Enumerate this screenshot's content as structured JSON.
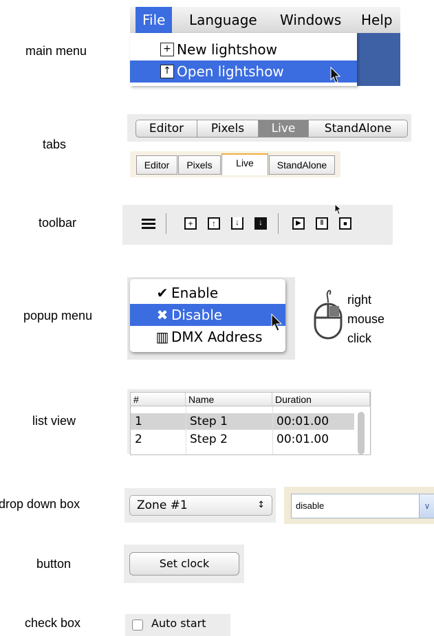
{
  "labels": {
    "main_menu": "main menu",
    "tabs": "tabs",
    "toolbar": "toolbar",
    "popup_menu": "popup menu",
    "list_view": "list view",
    "drop_down_box": "drop down box",
    "button": "button",
    "check_box": "check box"
  },
  "main_menu": {
    "items": [
      "File",
      "Language",
      "Windows",
      "Help"
    ],
    "active_item": "File",
    "dropdown": [
      "New lightshow",
      "Open lightshow"
    ],
    "highlighted": "Open lightshow"
  },
  "tabs_mac": {
    "items": [
      "Editor",
      "Pixels",
      "Live",
      "StandAlone"
    ],
    "selected": "Live"
  },
  "tabs_classic": {
    "items": [
      "Editor",
      "Pixels",
      "Live",
      "StandAlone"
    ],
    "selected": "Live"
  },
  "toolbar": {
    "icons": [
      "menu-icon",
      "new-file-icon",
      "open-file-icon",
      "download-icon",
      "save-icon",
      "play-icon",
      "pause-icon",
      "stop-icon"
    ]
  },
  "popup_menu": {
    "items": [
      {
        "label": "Enable",
        "icon": "check-icon"
      },
      {
        "label": "Disable",
        "icon": "x-icon"
      },
      {
        "label": "DMX Address",
        "icon": "dmx-icon"
      }
    ],
    "highlighted": "Disable",
    "hint": [
      "right",
      "mouse",
      "click"
    ]
  },
  "list_view": {
    "columns": [
      "#",
      "Name",
      "Duration"
    ],
    "rows": [
      {
        "num": "1",
        "name": "Step 1",
        "duration": "00:01.00"
      },
      {
        "num": "2",
        "name": "Step 2",
        "duration": "00:01.00"
      }
    ],
    "selected_row": "1"
  },
  "dropdown_mac": {
    "value": "Zone #1",
    "arrow": "↕"
  },
  "dropdown_classic": {
    "value": "disable",
    "arrow": "∨"
  },
  "button": {
    "label": "Set clock"
  },
  "checkbox": {
    "label": "Auto start",
    "checked": false
  },
  "colors": {
    "selection_blue": "#3b6ce0",
    "tab_active_gray": "#8a8a8a"
  }
}
